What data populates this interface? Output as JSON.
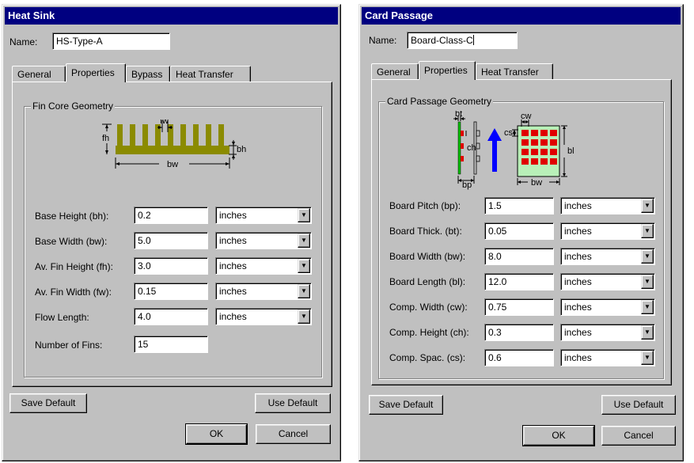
{
  "heat_sink": {
    "title": "Heat Sink",
    "name_label": "Name:",
    "name_value": "HS-Type-A",
    "tabs": [
      "General",
      "Properties",
      "Bypass",
      "Heat Transfer"
    ],
    "active_tab": "Properties",
    "group_title": "Fin Core Geometry",
    "diagram_labels": {
      "fw": "fw",
      "fh": "fh",
      "bh": "bh",
      "bw": "bw"
    },
    "fields": [
      {
        "label": "Base Height (bh):",
        "value": "0.2",
        "unit": "inches"
      },
      {
        "label": "Base Width (bw):",
        "value": "5.0",
        "unit": "inches"
      },
      {
        "label": "Av. Fin Height (fh):",
        "value": "3.0",
        "unit": "inches"
      },
      {
        "label": "Av. Fin Width (fw):",
        "value": "0.15",
        "unit": "inches"
      },
      {
        "label": "Flow Length:",
        "value": "4.0",
        "unit": "inches"
      },
      {
        "label": "Number of Fins:",
        "value": "15"
      }
    ],
    "buttons": {
      "save_default": "Save Default",
      "use_default": "Use Default",
      "ok": "OK",
      "cancel": "Cancel"
    }
  },
  "card_passage": {
    "title": "Card Passage",
    "name_label": "Name:",
    "name_value": "Board-Class-C",
    "tabs": [
      "General",
      "Properties",
      "Heat Transfer"
    ],
    "active_tab": "Properties",
    "group_title": "Card Passage Geometry",
    "diagram_labels": {
      "bt": "bt",
      "ch": "ch",
      "bp": "bp",
      "cw": "cw",
      "cs": "cs",
      "bl": "bl",
      "bw": "bw"
    },
    "fields": [
      {
        "label": "Board Pitch (bp):",
        "value": "1.5",
        "unit": "inches"
      },
      {
        "label": "Board Thick. (bt):",
        "value": "0.05",
        "unit": "inches"
      },
      {
        "label": "Board Width (bw):",
        "value": "8.0",
        "unit": "inches"
      },
      {
        "label": "Board Length (bl):",
        "value": "12.0",
        "unit": "inches"
      },
      {
        "label": "Comp. Width (cw):",
        "value": "0.75",
        "unit": "inches"
      },
      {
        "label": "Comp. Height (ch):",
        "value": "0.3",
        "unit": "inches"
      },
      {
        "label": "Comp. Spac. (cs):",
        "value": "0.6",
        "unit": "inches"
      }
    ],
    "buttons": {
      "save_default": "Save Default",
      "use_default": "Use Default",
      "ok": "OK",
      "cancel": "Cancel"
    }
  },
  "colors": {
    "titlebar": "#000080",
    "fin": "#8b8b00",
    "board_green": "#00c000",
    "component_red": "#e00000",
    "flow_arrow": "#0000ff",
    "grid_bg": "#b8f0b8"
  }
}
